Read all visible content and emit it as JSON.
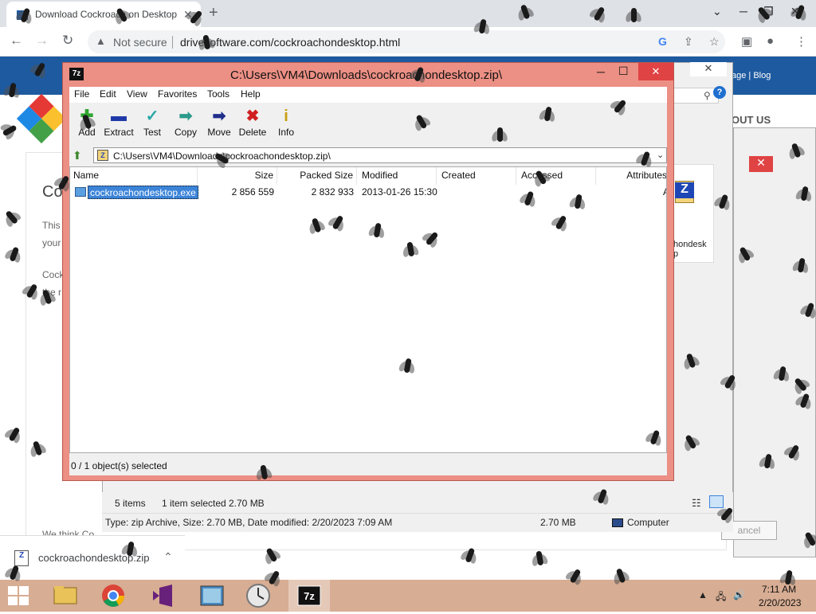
{
  "browser": {
    "tab_title": "Download Cockroach on Desktop",
    "tab_close": "✕",
    "new_tab": "+",
    "not_secure": "Not secure",
    "url": "drivesoftware.com/cockroachondesktop.html"
  },
  "site": {
    "header_links": "age | Blog",
    "about": "OUT US",
    "heading": "Co",
    "lines": [
      "This",
      "your",
      "Cock",
      "the r",
      "We think Co"
    ]
  },
  "explorer": {
    "file_tile_label": "hondesk\np",
    "items": "5 items",
    "selected": "1 item selected",
    "selected_size": "2.70 MB",
    "details": "Type: zip Archive, Size: 2.70 MB, Date modified: 2/20/2023 7:09 AM",
    "details_size": "2.70 MB",
    "location": "Computer"
  },
  "dialog": {
    "cancel": "ancel"
  },
  "downloads": {
    "file": "cockroachondesktop.zip"
  },
  "sevenzip": {
    "title": "C:\\Users\\VM4\\Downloads\\cockroachondesktop.zip\\",
    "app_icon": "7z",
    "menu": [
      "File",
      "Edit",
      "View",
      "Favorites",
      "Tools",
      "Help"
    ],
    "tools": [
      {
        "label": "Add",
        "icon": "plus-icon",
        "glyph": "+",
        "color": "#2fa52f"
      },
      {
        "label": "Extract",
        "icon": "minus-icon",
        "glyph": "▬",
        "color": "#1f3aa8"
      },
      {
        "label": "Test",
        "icon": "check-icon",
        "glyph": "✓",
        "color": "#2aa7a7"
      },
      {
        "label": "Copy",
        "icon": "double-arrow-icon",
        "glyph": "➡",
        "color": "#2a9a8a"
      },
      {
        "label": "Move",
        "icon": "arrow-icon",
        "glyph": "➡",
        "color": "#1f2f8a"
      },
      {
        "label": "Delete",
        "icon": "x-icon",
        "glyph": "✖",
        "color": "#d01f1f"
      },
      {
        "label": "Info",
        "icon": "info-icon",
        "glyph": "i",
        "color": "#c8a010"
      }
    ],
    "address": "C:\\Users\\VM4\\Downloads\\cockroachondesktop.zip\\",
    "columns": [
      "Name",
      "Size",
      "Packed Size",
      "Modified",
      "Created",
      "Accessed",
      "Attributes"
    ],
    "rows": [
      {
        "name": "cockroachondesktop.exe",
        "size": "2 856 559",
        "packed": "2 832 933",
        "modified": "2013-01-26 15:30",
        "created": "",
        "accessed": "",
        "attributes": "A"
      }
    ],
    "status": "0 / 1 object(s) selected"
  },
  "taskbar": {
    "time": "7:11 AM",
    "date": "2/20/2023",
    "apps": [
      "file-explorer",
      "chrome",
      "visual-studio",
      "image-viewer",
      "clock-app",
      "7-zip"
    ]
  },
  "colors": {
    "sevenzip_frame": "#ec8f84",
    "taskbar": "#d7ad93",
    "site_header": "#1e5aa0",
    "selection": "#3b84d8"
  }
}
